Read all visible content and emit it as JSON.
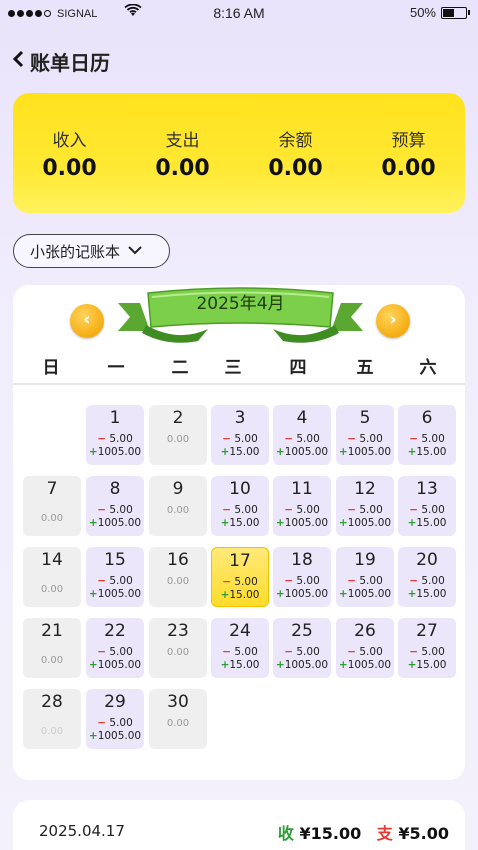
{
  "status": {
    "carrier": "SIGNAL",
    "time": "8:16 AM",
    "battery": "50%",
    "battery_level": 0.5,
    "wifi_icon": "wifi-icon"
  },
  "header": {
    "title": "账单日历",
    "back_icon": "chevron-left-icon"
  },
  "summary": {
    "items": [
      {
        "label": "收入",
        "value": "0.00"
      },
      {
        "label": "支出",
        "value": "0.00"
      },
      {
        "label": "余额",
        "value": "0.00"
      },
      {
        "label": "预算",
        "value": "0.00"
      }
    ]
  },
  "book_select": {
    "label": "小张的记账本",
    "icon": "chevron-down-icon"
  },
  "calendar": {
    "title": "2025年4月",
    "prev_icon": "‹",
    "next_icon": "›",
    "weekdays": [
      "日",
      "一",
      "二",
      "三",
      "四",
      "五",
      "六"
    ],
    "days": [
      {
        "num": "1",
        "exp": "5.00",
        "inc": "1005.00"
      },
      {
        "num": "2",
        "zero": "0.00"
      },
      {
        "num": "3",
        "exp": "5.00",
        "inc": "15.00"
      },
      {
        "num": "4",
        "exp": "5.00",
        "inc": "1005.00"
      },
      {
        "num": "5",
        "exp": "5.00",
        "inc": "1005.00"
      },
      {
        "num": "6",
        "exp": "5.00",
        "inc": "15.00"
      },
      {
        "num": "7",
        "zero": "0.00"
      },
      {
        "num": "8",
        "exp": "5.00",
        "inc": "1005.00"
      },
      {
        "num": "9",
        "zero": "0.00"
      },
      {
        "num": "10",
        "exp": "5.00",
        "inc": "15.00"
      },
      {
        "num": "11",
        "exp": "5.00",
        "inc": "1005.00"
      },
      {
        "num": "12",
        "exp": "5.00",
        "inc": "1005.00"
      },
      {
        "num": "13",
        "exp": "5.00",
        "inc": "15.00"
      },
      {
        "num": "14",
        "zero": "0.00"
      },
      {
        "num": "15",
        "exp": "5.00",
        "inc": "1005.00"
      },
      {
        "num": "16",
        "zero": "0.00"
      },
      {
        "num": "17",
        "exp": "5.00",
        "inc": "15.00"
      },
      {
        "num": "18",
        "exp": "5.00",
        "inc": "1005.00"
      },
      {
        "num": "19",
        "exp": "5.00",
        "inc": "1005.00"
      },
      {
        "num": "20",
        "exp": "5.00",
        "inc": "15.00"
      },
      {
        "num": "21",
        "zero": "0.00"
      },
      {
        "num": "22",
        "exp": "5.00",
        "inc": "1005.00"
      },
      {
        "num": "23",
        "zero": "0.00"
      },
      {
        "num": "24",
        "exp": "5.00",
        "inc": "15.00"
      },
      {
        "num": "25",
        "exp": "5.00",
        "inc": "1005.00"
      },
      {
        "num": "26",
        "exp": "5.00",
        "inc": "1005.00"
      },
      {
        "num": "27",
        "exp": "5.00",
        "inc": "15.00"
      },
      {
        "num": "28",
        "zero": "0.00"
      },
      {
        "num": "29",
        "exp": "5.00",
        "inc": "1005.00"
      },
      {
        "num": "30",
        "zero": "0.00"
      }
    ],
    "minus_sign": "−",
    "plus_sign": "+"
  },
  "detail": {
    "date": "2025.04.17",
    "income_label": "收",
    "income_value": "¥15.00",
    "expense_label": "支",
    "expense_value": "¥5.00"
  },
  "colors": {
    "summary_yellow": "#ffe21e",
    "income_green": "#2e9d34",
    "expense_red": "#e53935",
    "day_purple": "#ece6fa",
    "today_yellow": "#ffdc2a"
  }
}
